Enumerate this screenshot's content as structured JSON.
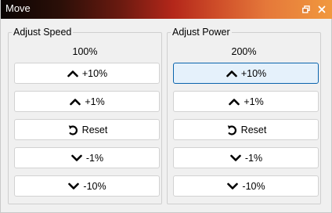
{
  "window": {
    "title": "Move",
    "titlebar_colors": [
      "#0a0403",
      "#b4271a",
      "#f1993e"
    ],
    "restore_icon": "restore-icon",
    "close_icon": "close-icon"
  },
  "speed": {
    "title": "Adjust Speed",
    "value": "100%",
    "buttons": [
      {
        "label": "+10%",
        "icon": "chevron-up-icon"
      },
      {
        "label": "+1%",
        "icon": "chevron-up-icon"
      },
      {
        "label": "Reset",
        "icon": "reset-icon"
      },
      {
        "label": "-1%",
        "icon": "chevron-down-icon"
      },
      {
        "label": "-10%",
        "icon": "chevron-down-icon"
      }
    ]
  },
  "power": {
    "title": "Adjust Power",
    "value": "200%",
    "buttons": [
      {
        "label": "+10%",
        "icon": "chevron-up-icon",
        "state": "hover"
      },
      {
        "label": "+1%",
        "icon": "chevron-up-icon"
      },
      {
        "label": "Reset",
        "icon": "reset-icon"
      },
      {
        "label": "-1%",
        "icon": "chevron-down-icon"
      },
      {
        "label": "-10%",
        "icon": "chevron-down-icon"
      }
    ]
  },
  "colors": {
    "hover_fill": "#e5f1fb",
    "hover_border": "#0a64ad"
  }
}
